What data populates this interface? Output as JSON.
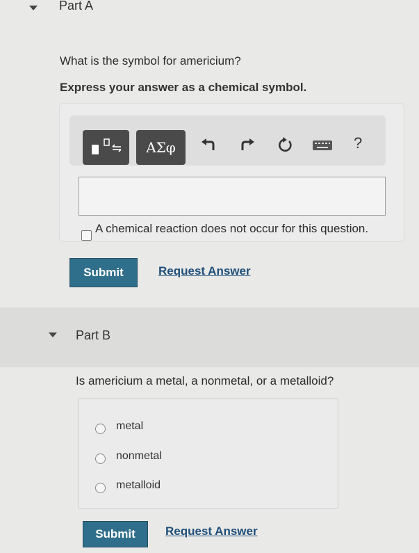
{
  "partA": {
    "title": "Part A",
    "question": "What is the symbol for americium?",
    "instruction": "Express your answer as a chemical symbol.",
    "toolbar": {
      "template_icon": "template-icon",
      "greek_label": "ΑΣφ",
      "undo_icon": "undo-icon",
      "redo_icon": "redo-icon",
      "reset_icon": "reset-icon",
      "keyboard_icon": "keyboard-icon",
      "help_label": "?"
    },
    "answer_value": "",
    "no_reaction_label": "A chemical reaction does not occur for this question.",
    "submit_label": "Submit",
    "request_label": "Request Answer"
  },
  "partB": {
    "title": "Part B",
    "question": "Is americium a metal, a nonmetal, or a metalloid?",
    "options": [
      "metal",
      "nonmetal",
      "metalloid"
    ],
    "submit_label": "Submit",
    "request_label": "Request Answer"
  },
  "colors": {
    "submit_bg": "#2f6f8b",
    "link": "#1f4f7a",
    "toolbar_button": "#4a4a4a"
  }
}
